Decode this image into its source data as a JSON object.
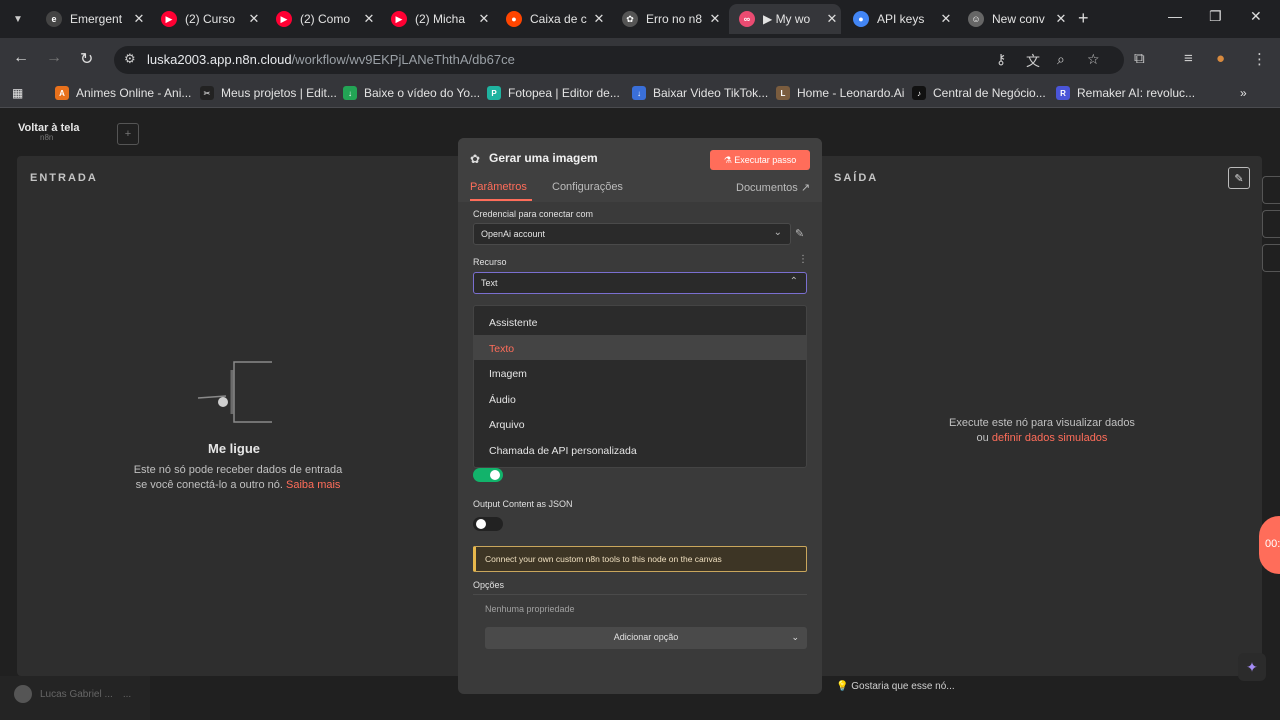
{
  "browser": {
    "tabs": [
      {
        "title": "Emergent",
        "favicon": "emergent-icon",
        "color": "#444444",
        "glyph": "e"
      },
      {
        "title": "(2) Curso",
        "favicon": "youtube-icon",
        "color": "#ff0033",
        "glyph": "▶"
      },
      {
        "title": "(2) Como",
        "favicon": "youtube-icon",
        "color": "#ff0033",
        "glyph": "▶"
      },
      {
        "title": "(2) Micha",
        "favicon": "youtube-icon",
        "color": "#ff0033",
        "glyph": "▶"
      },
      {
        "title": "Caixa de c",
        "favicon": "reddit-icon",
        "color": "#ff4500",
        "glyph": "●"
      },
      {
        "title": "Erro no n8",
        "favicon": "openai-icon",
        "color": "#555555",
        "glyph": "✿"
      },
      {
        "title": "▶ My wo",
        "favicon": "n8n-icon",
        "color": "#ea4b71",
        "glyph": "∞"
      },
      {
        "title": "API keys",
        "favicon": "api-icon",
        "color": "#4285f4",
        "glyph": "●"
      },
      {
        "title": "New conv",
        "favicon": "chat-icon",
        "color": "#666666",
        "glyph": "☺"
      }
    ],
    "active_tab": 6,
    "url_host": "luska2003.app.n8n.cloud",
    "url_path": "/workflow/wv9EKPjLANeThthA/db67ce",
    "bookmarks": [
      {
        "label": "Animes Online - Ani...",
        "color": "#e8711c",
        "glyph": "A"
      },
      {
        "label": "Meus projetos | Edit...",
        "color": "#222222",
        "glyph": "✂"
      },
      {
        "label": "Baixe o vídeo do Yo...",
        "color": "#23a455",
        "glyph": "↓"
      },
      {
        "label": "Fotopea | Editor de...",
        "color": "#1fb3a0",
        "glyph": "P"
      },
      {
        "label": "Baixar Video TikTok...",
        "color": "#3a6fd8",
        "glyph": "↓"
      },
      {
        "label": "Home - Leonardo.Ai",
        "color": "#7a5c3e",
        "glyph": "L"
      },
      {
        "label": "Central de Negócio...",
        "color": "#111111",
        "glyph": "♪"
      },
      {
        "label": "Remaker AI: revoluc...",
        "color": "#4a55d8",
        "glyph": "R"
      }
    ]
  },
  "app": {
    "back_label": "Voltar à tela",
    "back_sub": "n8n",
    "input_title": "ENTRADA",
    "output_title": "SAÍDA",
    "input_heading": "Me ligue",
    "input_text_1": "Este nó só pode receber dados de entrada",
    "input_text_2": "se você conectá-lo a outro nó.",
    "input_link": "Saiba mais",
    "output_text_1": "Execute este nó para visualizar dados",
    "output_text_2": "ou",
    "output_link": "definir dados simulados",
    "pill_text": "00:",
    "feedback": "Gostaria que esse nó...",
    "user": "Lucas Gabriel ...",
    "user_more": "..."
  },
  "node": {
    "title": "Gerar uma imagem",
    "execute_label": "Executar passo",
    "tabs": [
      "Parâmetros",
      "Configurações"
    ],
    "docs_label": "Documentos",
    "credential_label": "Credencial para conectar com",
    "credential_value": "OpenAi account",
    "resource_label": "Recurso",
    "resource_value": "Text",
    "resource_options": [
      "Assistente",
      "Texto",
      "Imagem",
      "Áudio",
      "Arquivo",
      "Chamada de API personalizada"
    ],
    "selected_option": 1,
    "output_json_label": "Output Content as JSON",
    "notice": "Connect your own custom n8n tools to this node on the canvas",
    "options_title": "Opções",
    "no_property": "Nenhuma propriedade",
    "add_option": "Adicionar opção"
  }
}
